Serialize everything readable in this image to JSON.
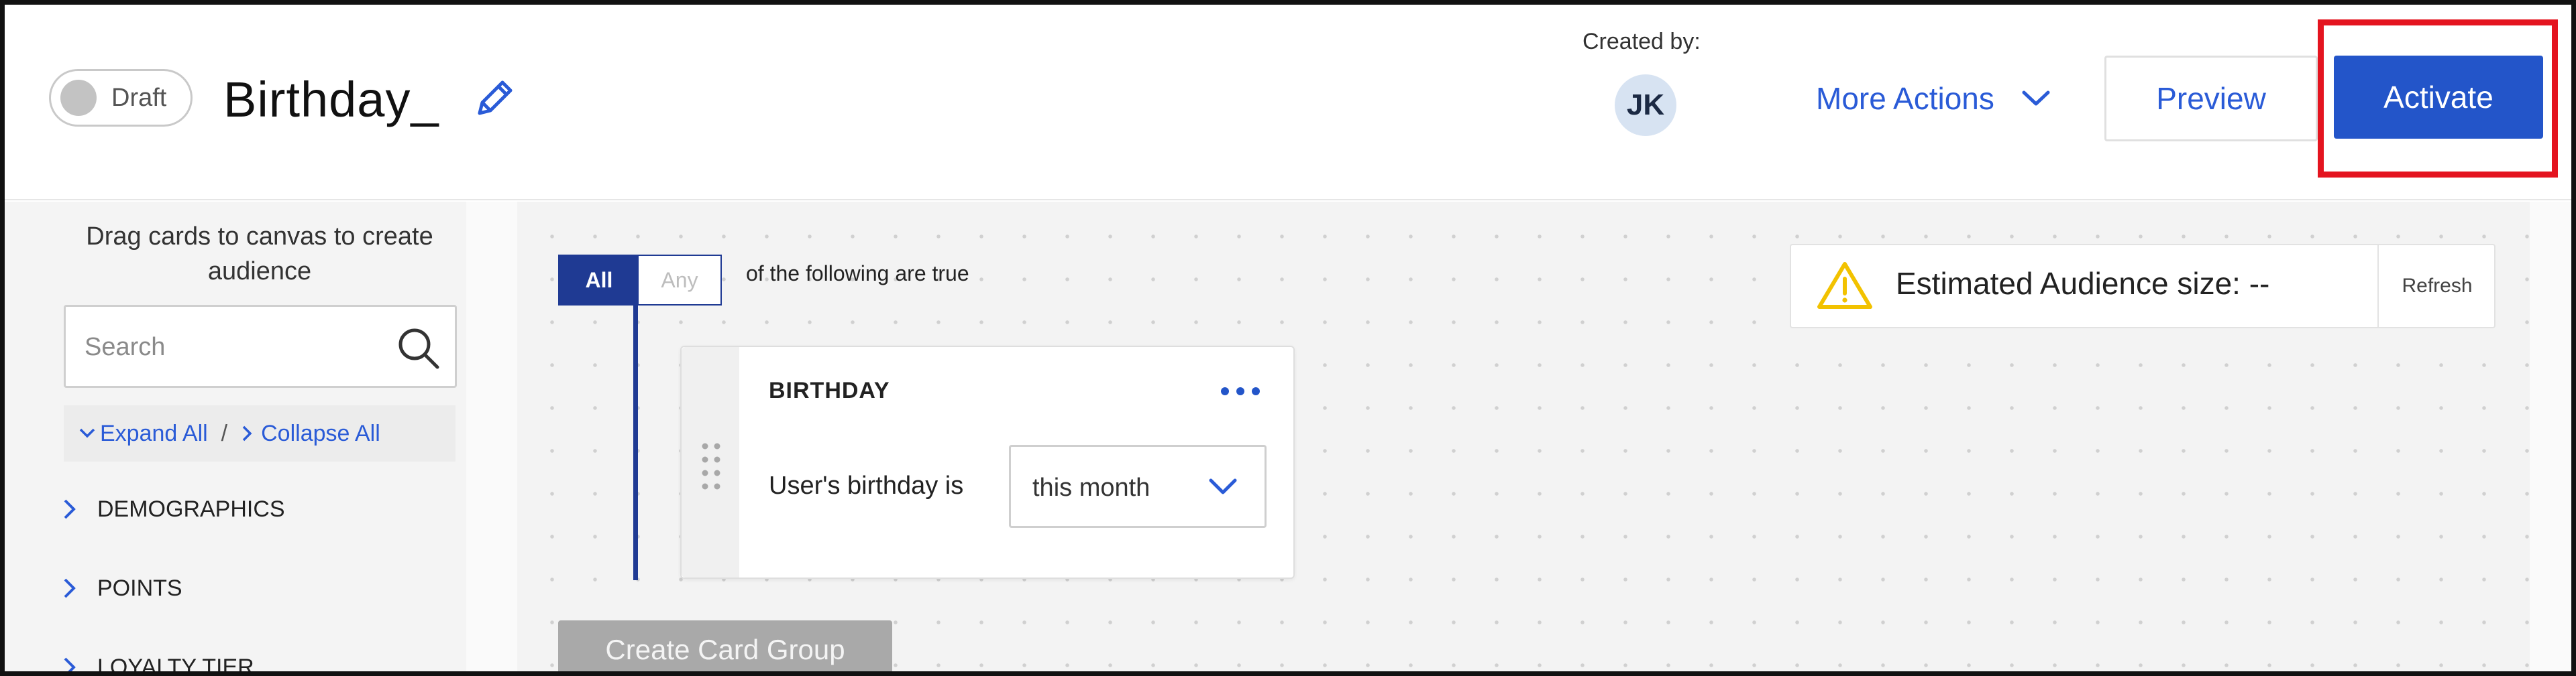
{
  "header": {
    "status_label": "Draft",
    "title": "Birthday_",
    "created_by_label": "Created by:",
    "creator_initials": "JK",
    "more_actions_label": "More Actions",
    "preview_label": "Preview",
    "activate_label": "Activate"
  },
  "sidebar": {
    "hint": "Drag cards to canvas to create audience",
    "search_placeholder": "Search",
    "expand_all": "Expand All",
    "separator": "/",
    "collapse_all": "Collapse All",
    "categories": [
      {
        "label": "DEMOGRAPHICS"
      },
      {
        "label": "POINTS"
      },
      {
        "label": "LOYALTY TIER"
      }
    ]
  },
  "canvas": {
    "match_all_label": "All",
    "match_any_label": "Any",
    "match_selected": "All",
    "condition_text": "of the following are true",
    "card": {
      "title": "BIRTHDAY",
      "field_label": "User's birthday is",
      "field_value": "this month"
    },
    "audience": {
      "text": "Estimated Audience size: --",
      "refresh_label": "Refresh"
    },
    "create_group_label": "Create Card Group"
  },
  "colors": {
    "primary": "#2355c9",
    "link": "#2a5bd7",
    "rail": "#1f3a93",
    "highlight": "#e4141f",
    "warning": "#f2c200"
  }
}
